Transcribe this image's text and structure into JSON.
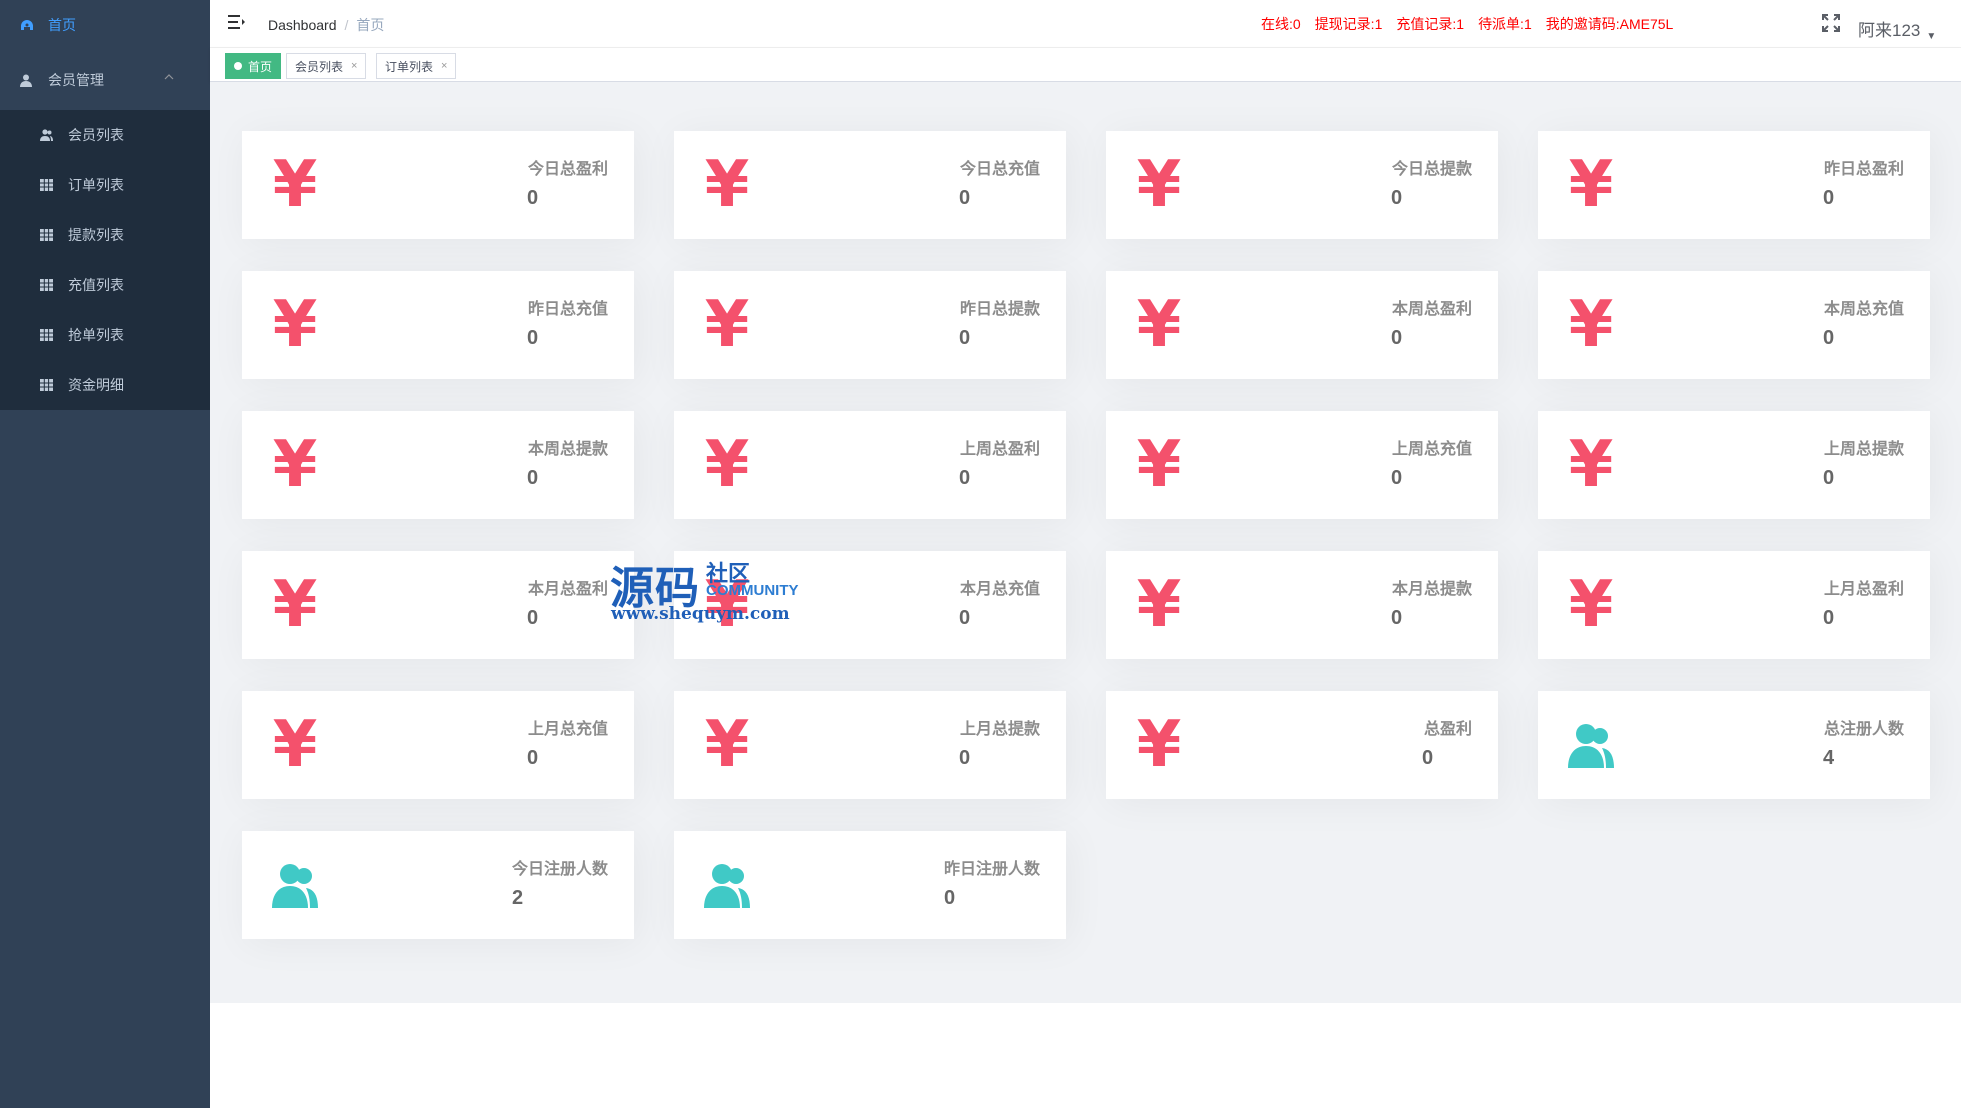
{
  "sidebar": {
    "home_label": "首页",
    "group_label": "会员管理",
    "items": [
      {
        "label": "会员列表",
        "icon": "users-icon"
      },
      {
        "label": "订单列表",
        "icon": "table-icon"
      },
      {
        "label": "提款列表",
        "icon": "table-icon"
      },
      {
        "label": "充值列表",
        "icon": "table-icon"
      },
      {
        "label": "抢单列表",
        "icon": "table-icon"
      },
      {
        "label": "资金明细",
        "icon": "table-icon"
      }
    ]
  },
  "header": {
    "breadcrumb": {
      "root": "Dashboard",
      "separator": "/",
      "current": "首页"
    },
    "stats": [
      "在线:0",
      "提现记录:1",
      "充值记录:1",
      "待派单:1",
      "我的邀请码:AME75L"
    ],
    "user": "阿来123"
  },
  "tags": [
    {
      "label": "首页",
      "active": true
    },
    {
      "label": "会员列表",
      "close": "×"
    },
    {
      "label": "订单列表",
      "close": "×"
    }
  ],
  "cards": [
    {
      "label": "今日总盈利",
      "value": "0",
      "icon": "yen"
    },
    {
      "label": "今日总充值",
      "value": "0",
      "icon": "yen"
    },
    {
      "label": "今日总提款",
      "value": "0",
      "icon": "yen"
    },
    {
      "label": "昨日总盈利",
      "value": "0",
      "icon": "yen"
    },
    {
      "label": "昨日总充值",
      "value": "0",
      "icon": "yen"
    },
    {
      "label": "昨日总提款",
      "value": "0",
      "icon": "yen"
    },
    {
      "label": "本周总盈利",
      "value": "0",
      "icon": "yen"
    },
    {
      "label": "本周总充值",
      "value": "0",
      "icon": "yen"
    },
    {
      "label": "本周总提款",
      "value": "0",
      "icon": "yen"
    },
    {
      "label": "上周总盈利",
      "value": "0",
      "icon": "yen"
    },
    {
      "label": "上周总充值",
      "value": "0",
      "icon": "yen"
    },
    {
      "label": "上周总提款",
      "value": "0",
      "icon": "yen"
    },
    {
      "label": "本月总盈利",
      "value": "0",
      "icon": "yen"
    },
    {
      "label": "本月总充值",
      "value": "0",
      "icon": "yen"
    },
    {
      "label": "本月总提款",
      "value": "0",
      "icon": "yen"
    },
    {
      "label": "上月总盈利",
      "value": "0",
      "icon": "yen"
    },
    {
      "label": "上月总充值",
      "value": "0",
      "icon": "yen"
    },
    {
      "label": "上月总提款",
      "value": "0",
      "icon": "yen"
    },
    {
      "label": "总盈利",
      "value": "0",
      "icon": "yen"
    },
    {
      "label": "总注册人数",
      "value": "4",
      "icon": "people"
    },
    {
      "label": "今日注册人数",
      "value": "2",
      "icon": "people"
    },
    {
      "label": "昨日注册人数",
      "value": "0",
      "icon": "people"
    }
  ],
  "icons": {
    "yen_glyph": "¥"
  },
  "watermark": {
    "big": "源码",
    "small": "社区",
    "community": "COMMUNITY",
    "url": "www.shequym.com"
  },
  "colors": {
    "sidebar_bg": "#304156",
    "sidebar_active": "#409eff",
    "yen_red": "#f4516c",
    "people_teal": "#40c9c6",
    "tag_active": "#42b983",
    "stats_red": "#ff0000"
  }
}
